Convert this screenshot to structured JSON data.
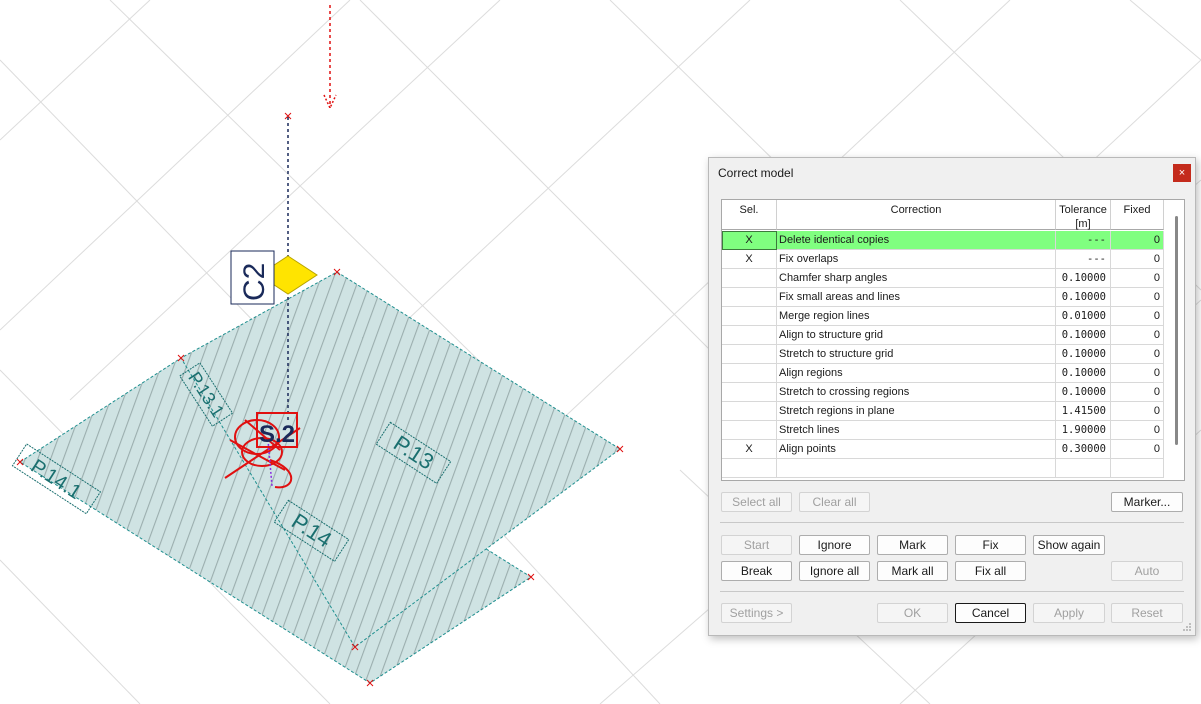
{
  "viewport": {
    "labels": {
      "column": "C2",
      "slab": "S.2",
      "p14": "P.14",
      "p13": "P.13",
      "p141": "P.14.1",
      "p131": "P.13.1"
    },
    "colors": {
      "plate_fill": "#cfe3e3",
      "edge": "#1f8f8f",
      "hatch": "#8a9c9c",
      "error": "#e01010",
      "node": "#ffe400",
      "text": "#1a6f6f"
    }
  },
  "dialog": {
    "title": "Correct model",
    "close_icon": "×",
    "columns": {
      "sel": "Sel.",
      "correction": "Correction",
      "tolerance": "Tolerance\n[m]",
      "fixed": "Fixed"
    },
    "rows": [
      {
        "sel": "X",
        "name": "Delete identical copies",
        "tol": "---",
        "fixed": "0",
        "highlight": true
      },
      {
        "sel": "X",
        "name": "Fix overlaps",
        "tol": "---",
        "fixed": "0"
      },
      {
        "sel": "",
        "name": "Chamfer sharp angles",
        "tol": "0.10000",
        "fixed": "0"
      },
      {
        "sel": "",
        "name": "Fix small areas and lines",
        "tol": "0.10000",
        "fixed": "0"
      },
      {
        "sel": "",
        "name": "Merge region lines",
        "tol": "0.01000",
        "fixed": "0"
      },
      {
        "sel": "",
        "name": "Align to structure grid",
        "tol": "0.10000",
        "fixed": "0"
      },
      {
        "sel": "",
        "name": "Stretch to structure grid",
        "tol": "0.10000",
        "fixed": "0"
      },
      {
        "sel": "",
        "name": "Align regions",
        "tol": "0.10000",
        "fixed": "0"
      },
      {
        "sel": "",
        "name": "Stretch to crossing regions",
        "tol": "0.10000",
        "fixed": "0"
      },
      {
        "sel": "",
        "name": "Stretch regions in plane",
        "tol": "1.41500",
        "fixed": "0"
      },
      {
        "sel": "",
        "name": "Stretch lines",
        "tol": "1.90000",
        "fixed": "0"
      },
      {
        "sel": "X",
        "name": "Align points",
        "tol": "0.30000",
        "fixed": "0"
      },
      {
        "sel": "",
        "name": "",
        "tol": "",
        "fixed": ""
      }
    ],
    "buttons": {
      "select_all": "Select all",
      "clear_all": "Clear all",
      "marker": "Marker...",
      "start": "Start",
      "ignore": "Ignore",
      "mark": "Mark",
      "fix": "Fix",
      "show_again": "Show again",
      "break": "Break",
      "ignore_all": "Ignore all",
      "mark_all": "Mark all",
      "fix_all": "Fix all",
      "auto": "Auto",
      "settings": "Settings >",
      "ok": "OK",
      "cancel": "Cancel",
      "apply": "Apply",
      "reset": "Reset"
    }
  }
}
